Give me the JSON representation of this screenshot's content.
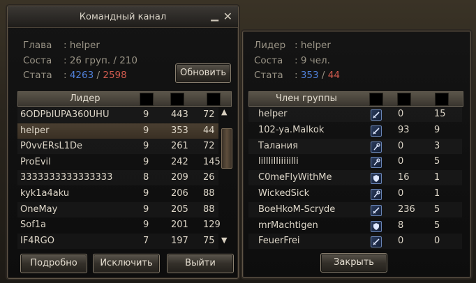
{
  "left_window": {
    "title": "Командный канал",
    "info": {
      "leader_label": "Глава",
      "leader_value": "helper",
      "composition_label": "Соста",
      "composition_value": "26 груп. / 210",
      "stats_label": "Стата",
      "stats_blue": "4263",
      "stats_sep": "/",
      "stats_red": "2598"
    },
    "refresh_button": "Обновить",
    "table": {
      "header": "Лидер",
      "rows": [
        {
          "name": "6ODPbIUPA360UHU",
          "c1": "9",
          "c2": "443",
          "c3": "72"
        },
        {
          "name": "helper",
          "c1": "9",
          "c2": "353",
          "c3": "44"
        },
        {
          "name": "P0vvERsL1De",
          "c1": "9",
          "c2": "261",
          "c3": "72"
        },
        {
          "name": "ProEvil",
          "c1": "9",
          "c2": "242",
          "c3": "145"
        },
        {
          "name": "3333333333333333",
          "c1": "8",
          "c2": "209",
          "c3": "26"
        },
        {
          "name": "kyk1a4aku",
          "c1": "9",
          "c2": "206",
          "c3": "88"
        },
        {
          "name": "OneMay",
          "c1": "9",
          "c2": "205",
          "c3": "88"
        },
        {
          "name": "Sof1a",
          "c1": "9",
          "c2": "201",
          "c3": "129"
        },
        {
          "name": "IF4RGO",
          "c1": "7",
          "c2": "197",
          "c3": "75"
        }
      ]
    },
    "buttons": {
      "details": "Подробно",
      "exclude": "Исключить",
      "leave": "Выйти"
    }
  },
  "right_window": {
    "info": {
      "leader_label": "Лидер",
      "leader_value": "helper",
      "composition_label": "Соста",
      "composition_value": "9 чел.",
      "stats_label": "Стата",
      "stats_blue": "353",
      "stats_sep": "/",
      "stats_red": "44"
    },
    "table": {
      "header": "Член группы",
      "rows": [
        {
          "name": "helper",
          "icon": "sword-class-icon",
          "c2": "0",
          "c3": "15"
        },
        {
          "name": "102-ya.Malkok",
          "icon": "sword-class-icon",
          "c2": "93",
          "c3": "9"
        },
        {
          "name": "Талания",
          "icon": "staff-class-icon",
          "c2": "0",
          "c3": "3"
        },
        {
          "name": "lilllilliiiiilli",
          "icon": "staff-class-icon",
          "c2": "0",
          "c3": "5"
        },
        {
          "name": "C0meFlyWithMe",
          "icon": "shield-class-icon",
          "c2": "16",
          "c3": "1"
        },
        {
          "name": "WickedSick",
          "icon": "staff-class-icon",
          "c2": "0",
          "c3": "1"
        },
        {
          "name": "BoeHkoM-Scryde",
          "icon": "sword-class-icon",
          "c2": "236",
          "c3": "5"
        },
        {
          "name": "mrMachtigen",
          "icon": "shield-class-icon",
          "c2": "8",
          "c3": "5"
        },
        {
          "name": "FeuerFrei",
          "icon": "sword-class-icon",
          "c2": "0",
          "c3": "0"
        }
      ]
    },
    "close_button": "Закрыть"
  }
}
